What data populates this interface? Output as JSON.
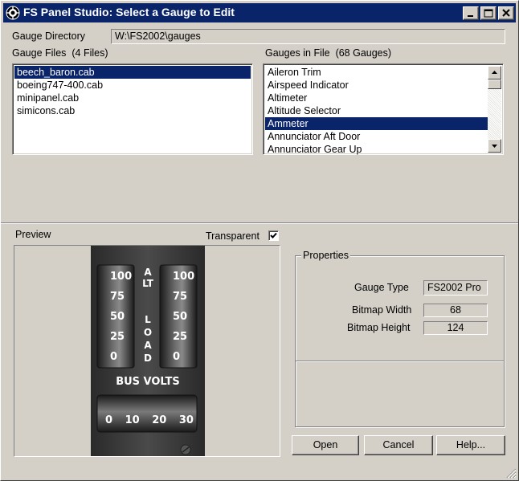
{
  "window": {
    "title": "FS Panel Studio: Select a Gauge to Edit"
  },
  "gauge_directory": {
    "label": "Gauge Directory",
    "value": "W:\\FS2002\\gauges"
  },
  "gauge_files": {
    "label": "Gauge Files",
    "count_label": "(4 Files)",
    "items": [
      "beech_baron.cab",
      "boeing747-400.cab",
      "minipanel.cab",
      "simicons.cab"
    ],
    "selected": "beech_baron.cab"
  },
  "gauges_in_file": {
    "label": "Gauges in File",
    "count_label": "(68 Gauges)",
    "items": [
      "Aileron Trim",
      "Airspeed Indicator",
      "Altimeter",
      "Altitude Selector",
      "Ammeter",
      "Annunciator Aft Door",
      "Annunciator Gear Up"
    ],
    "selected": "Ammeter"
  },
  "preview": {
    "label": "Preview",
    "transparent_label": "Transparent",
    "transparent_checked": true,
    "gauge_face": {
      "left_ticks": [
        "100",
        "75",
        "50",
        "25",
        "0"
      ],
      "right_ticks": [
        "100",
        "75",
        "50",
        "25",
        "0"
      ],
      "alt_text": "ALT",
      "load_text": "LOAD",
      "bus_volts_text": "BUS VOLTS",
      "volt_ticks": [
        "0",
        "10",
        "20",
        "30"
      ]
    }
  },
  "properties": {
    "title": "Properties",
    "gauge_type_label": "Gauge Type",
    "gauge_type_value": "FS2002 Pro",
    "bitmap_width_label": "Bitmap Width",
    "bitmap_width_value": "68",
    "bitmap_height_label": "Bitmap Height",
    "bitmap_height_value": "124"
  },
  "buttons": {
    "open": "Open",
    "cancel": "Cancel",
    "help": "Help..."
  },
  "colors": {
    "titlebar": "#0a246a",
    "face": "#d4d0c8",
    "selection": "#0a246a"
  }
}
